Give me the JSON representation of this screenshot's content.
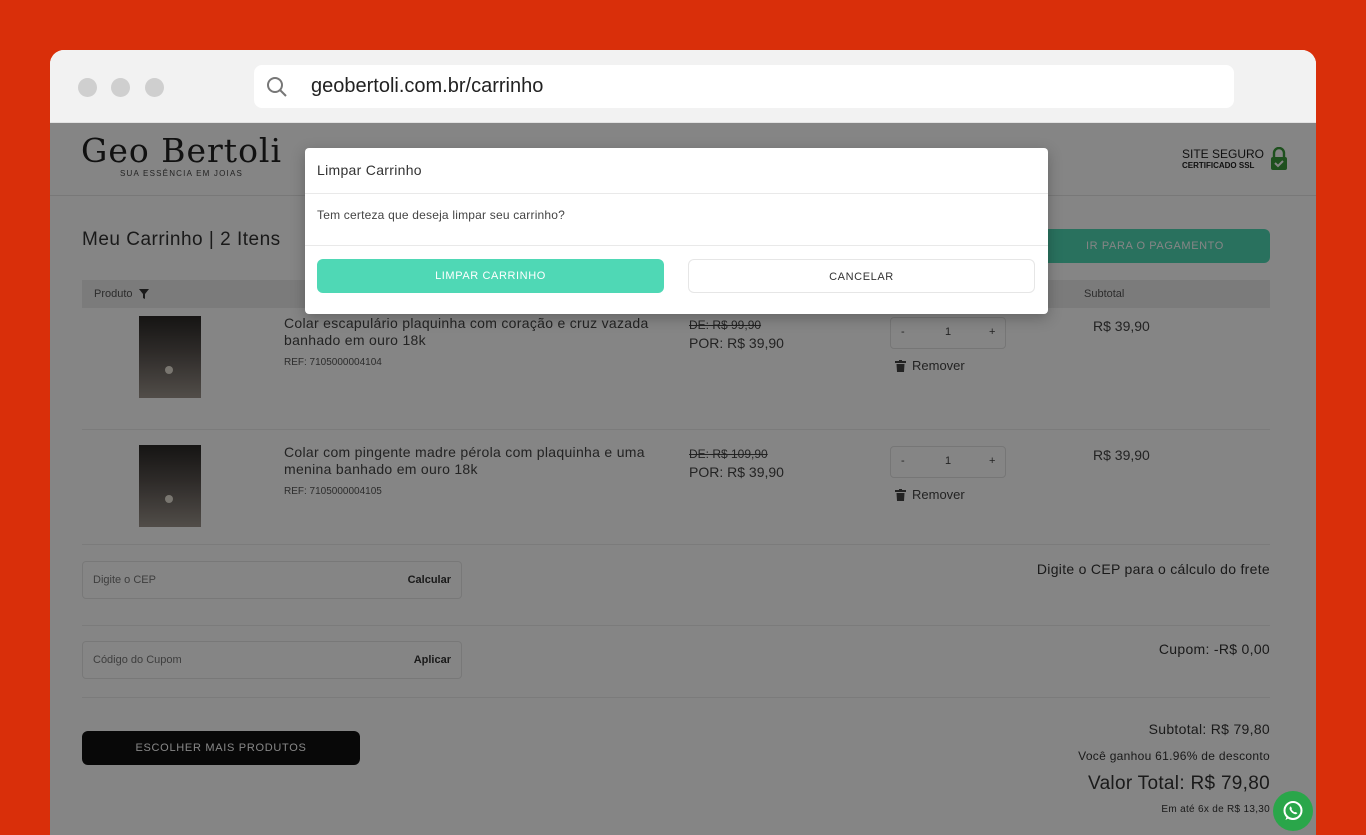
{
  "browser": {
    "url": "geobertoli.com.br/carrinho"
  },
  "header": {
    "brand": "Geo Bertoli",
    "tagline": "SUA ESSÊNCIA EM JOIAS",
    "secure_line1": "SITE SEGURO",
    "secure_line2": "CERTIFICADO SSL"
  },
  "cart": {
    "title": "Meu Carrinho | 2 Itens",
    "pay_button": "IR PARA O PAGAMENTO",
    "columns": {
      "product": "Produto",
      "subtotal": "Subtotal"
    },
    "items": [
      {
        "name": "Colar escapulário plaquinha com coração e cruz vazada banhado em ouro 18k",
        "ref": "REF: 7105000004104",
        "old_price": "DE: R$ 99,90",
        "new_price": "POR: R$ 39,90",
        "qty": "1",
        "minus": "-",
        "plus": "+",
        "remove": "Remover",
        "subtotal": "R$ 39,90"
      },
      {
        "name": "Colar com pingente madre pérola com plaquinha e uma menina banhado em ouro 18k",
        "ref": "REF: 7105000004105",
        "old_price": "DE: R$ 109,90",
        "new_price": "POR: R$ 39,90",
        "qty": "1",
        "minus": "-",
        "plus": "+",
        "remove": "Remover",
        "subtotal": "R$ 39,90"
      }
    ],
    "cep": {
      "placeholder": "Digite o CEP",
      "action": "Calcular",
      "hint": "Digite o CEP para o cálculo do frete"
    },
    "coupon": {
      "placeholder": "Código do Cupom",
      "action": "Aplicar",
      "value": "Cupom: -R$ 0,00"
    },
    "more_button": "ESCOLHER MAIS PRODUTOS",
    "totals": {
      "subtotal": "Subtotal: R$ 79,80",
      "discount": "Você ganhou 61.96% de desconto",
      "total": "Valor Total:  R$ 79,80",
      "installments": "Em até 6x de R$ 13,30"
    }
  },
  "modal": {
    "title": "Limpar Carrinho",
    "body": "Tem certeza que deseja limpar seu carrinho?",
    "confirm": "LIMPAR CARRINHO",
    "cancel": "CANCELAR"
  },
  "colors": {
    "background": "#d92f0a",
    "accent": "#4fd8b5",
    "whatsapp": "#2aa64a"
  }
}
